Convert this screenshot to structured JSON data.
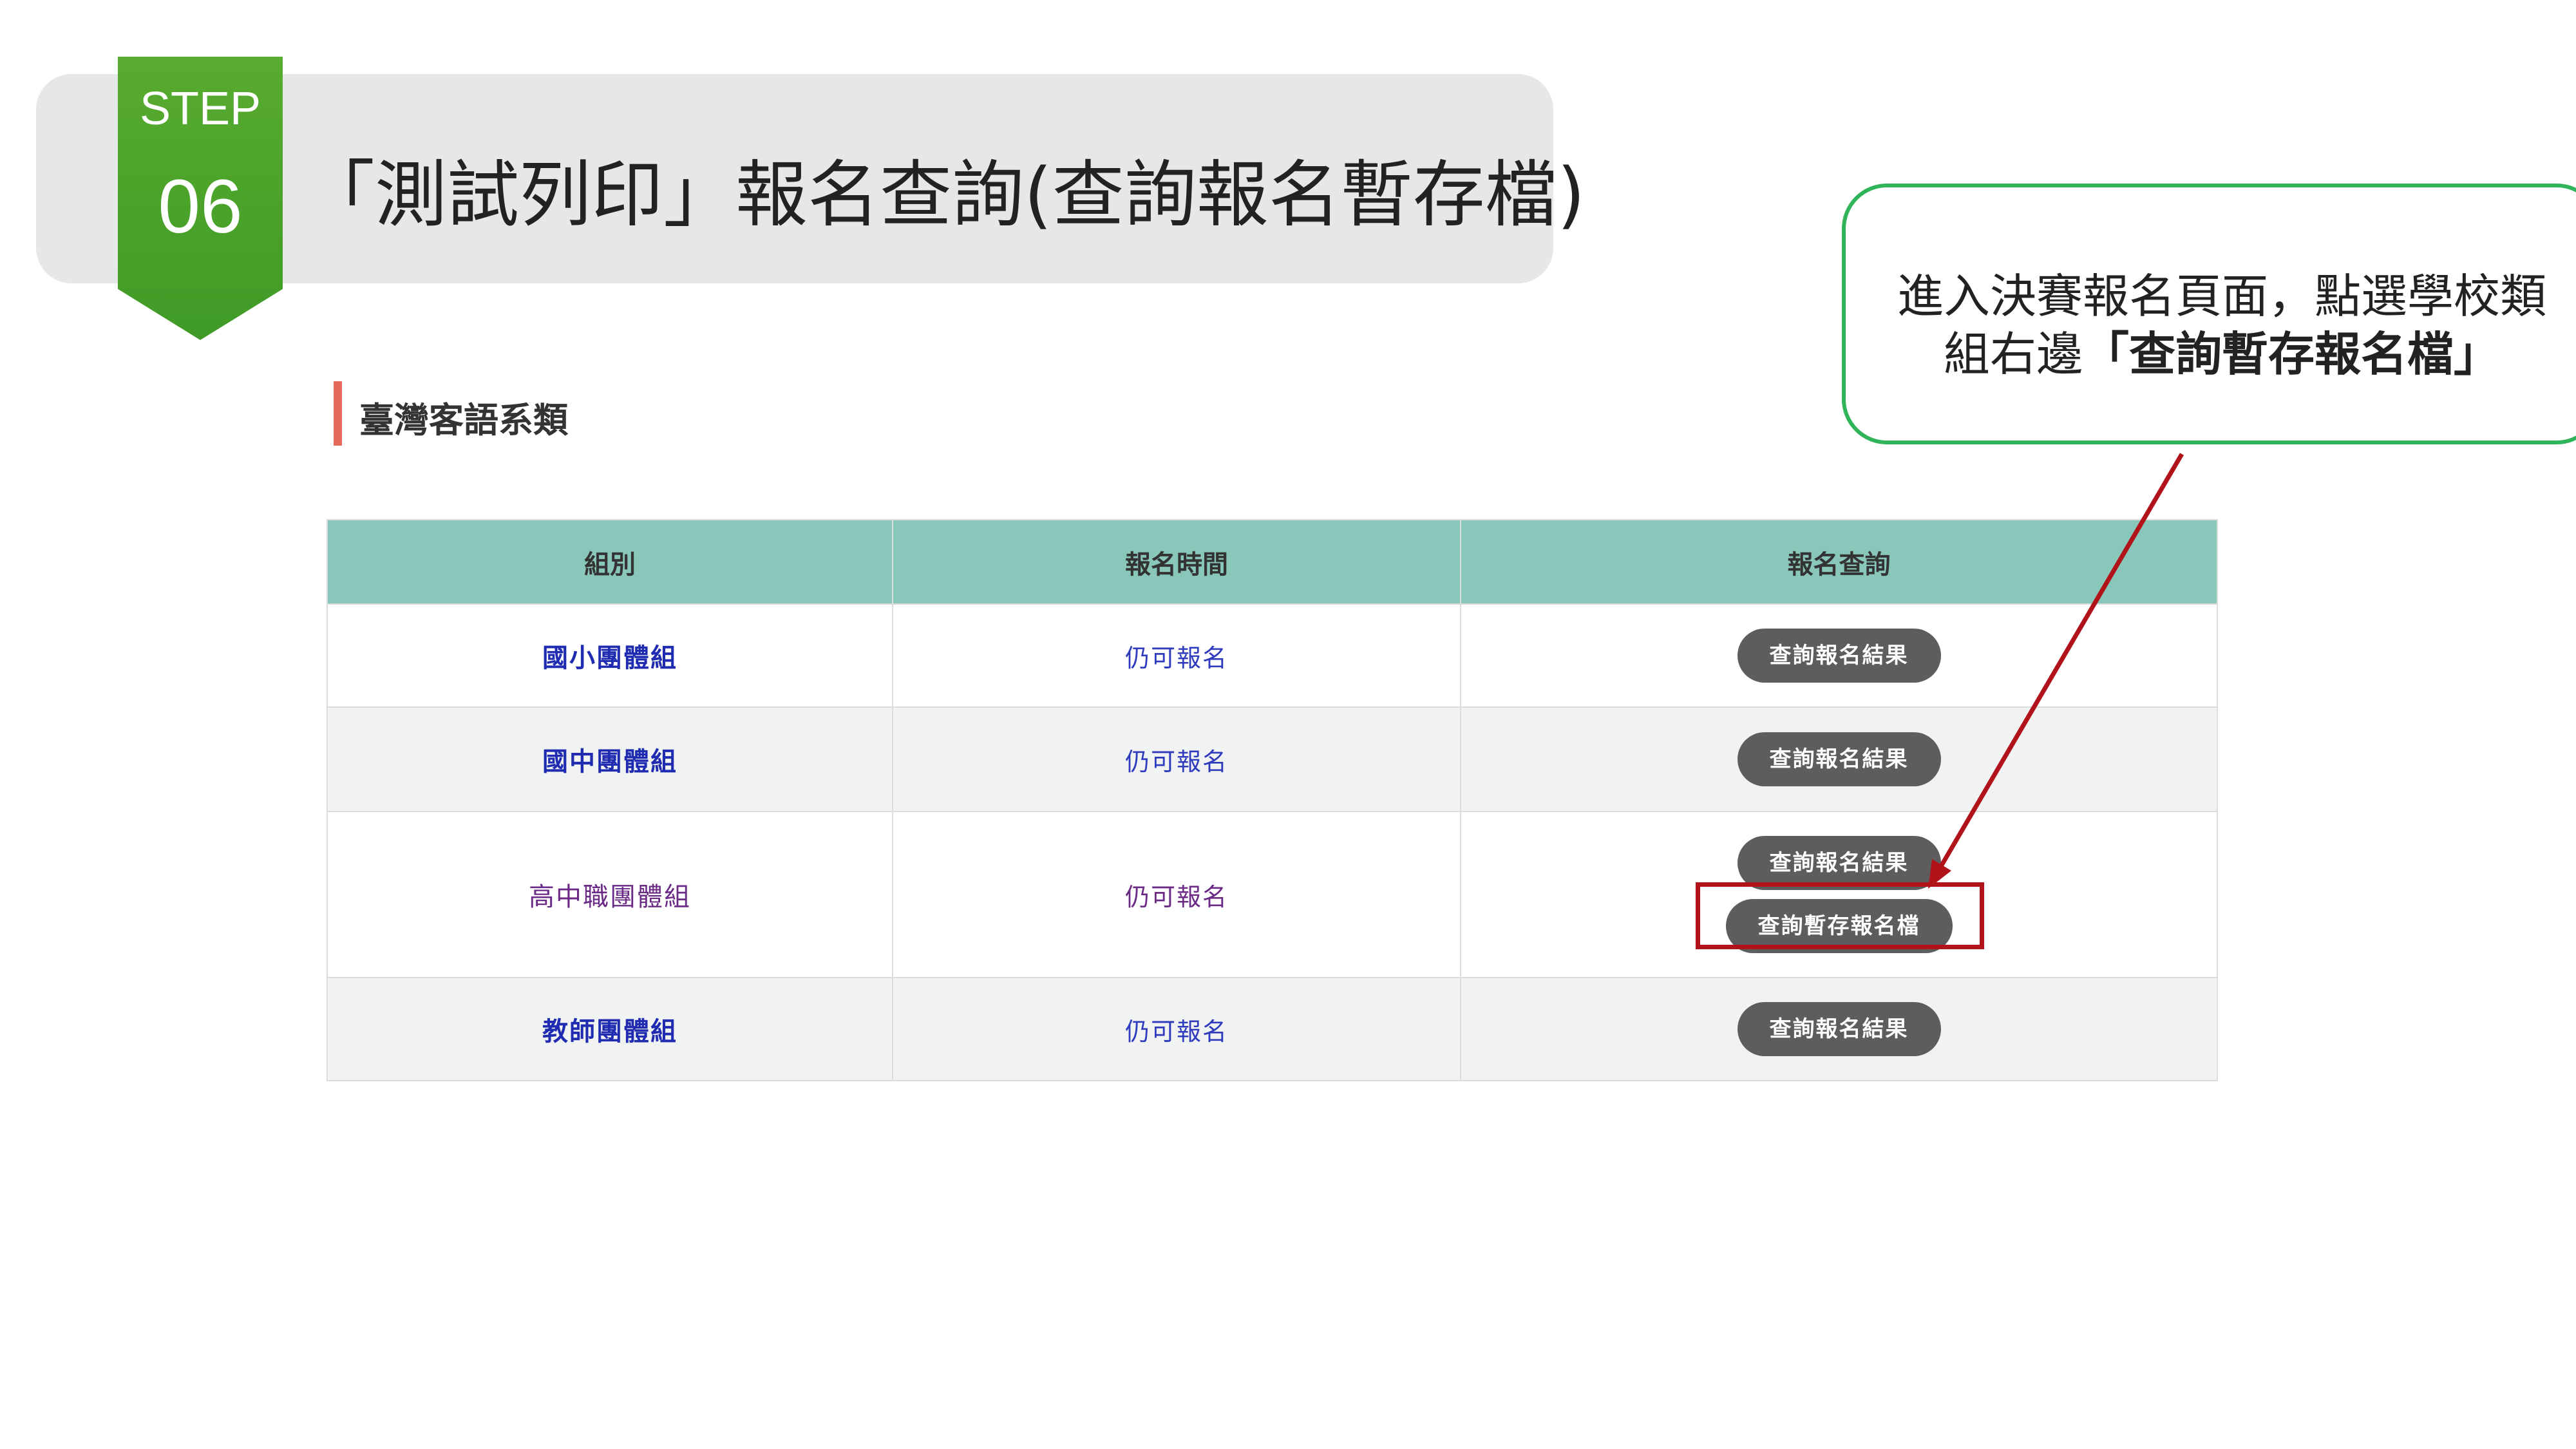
{
  "header": {
    "step_label": "STEP",
    "step_number": "06",
    "title": "「測試列印」報名查詢(查詢報名暫存檔)"
  },
  "section": {
    "title": "臺灣客語系類"
  },
  "table": {
    "columns": [
      "組別",
      "報名時間",
      "報名查詢"
    ],
    "rows": [
      {
        "group": "國小團體組",
        "time": "仍可報名",
        "buttons": [
          "查詢報名結果"
        ]
      },
      {
        "group": "國中團體組",
        "time": "仍可報名",
        "buttons": [
          "查詢報名結果"
        ]
      },
      {
        "group": "高中職團體組",
        "time": "仍可報名",
        "buttons": [
          "查詢報名結果",
          "查詢暫存報名檔"
        ]
      },
      {
        "group": "教師團體組",
        "time": "仍可報名",
        "buttons": [
          "查詢報名結果"
        ]
      }
    ]
  },
  "callout": {
    "line1": "進入決賽報名頁面，點選學校類",
    "line2_prefix": "組右邊",
    "line2_bold": "「查詢暫存報名檔」"
  },
  "colors": {
    "step_green": "#4aa22a",
    "header_teal": "#88c7b9",
    "highlight_red": "#b1131a",
    "callout_green": "#2fb45a",
    "button_gray": "#5d5d5d"
  }
}
